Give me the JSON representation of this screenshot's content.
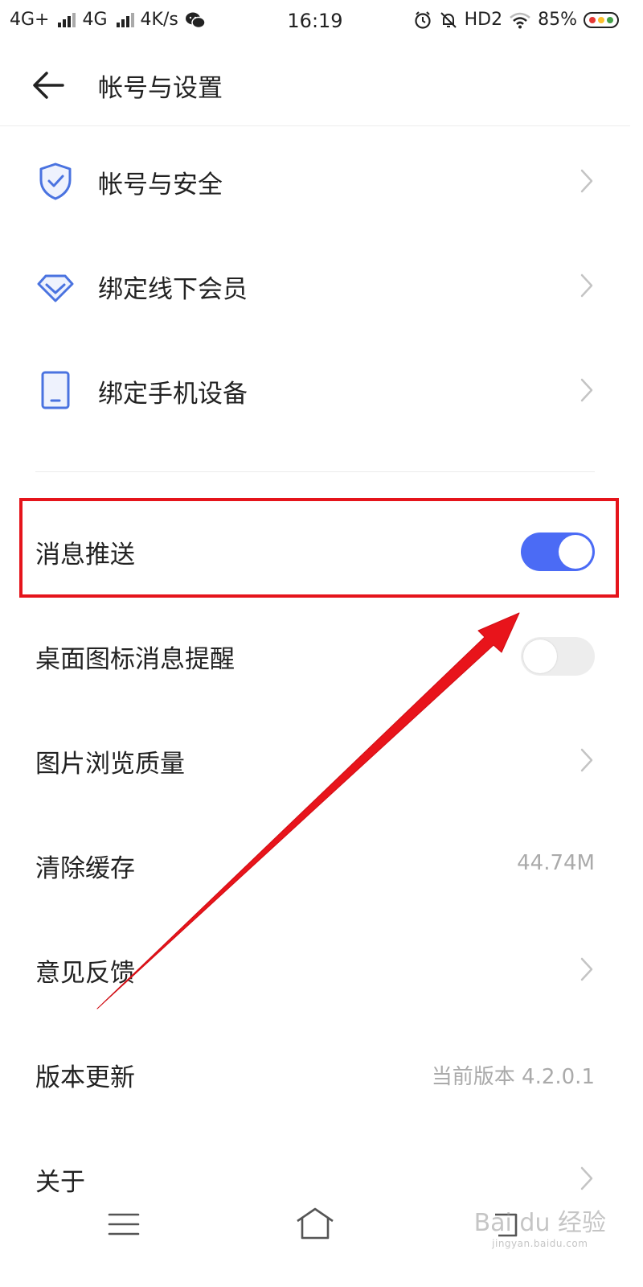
{
  "status_bar": {
    "network1": "4G+",
    "network2": "4G",
    "speed": "4K/s",
    "time": "16:19",
    "hd": "HD2",
    "battery": "85%"
  },
  "header": {
    "title": "帐号与设置"
  },
  "settings": {
    "account_security": "帐号与安全",
    "bind_member": "绑定线下会员",
    "bind_device": "绑定手机设备",
    "push_message": {
      "label": "消息推送",
      "on": true
    },
    "badge_reminder": {
      "label": "桌面图标消息提醒",
      "on": false
    },
    "image_quality": "图片浏览质量",
    "clear_cache": {
      "label": "清除缓存",
      "value": "44.74M"
    },
    "feedback": "意见反馈",
    "version": {
      "label": "版本更新",
      "value": "当前版本 4.2.0.1"
    },
    "about": "关于"
  },
  "watermark": {
    "brand": "Bai du 经验",
    "url": "jingyan.baidu.com"
  },
  "colors": {
    "accent": "#4b6bf5",
    "icon_blue": "#4a73e0",
    "annotation_red": "#e5141b"
  },
  "icons": {
    "back": "arrow-left-icon",
    "shield": "shield-check-icon",
    "diamond": "diamond-icon",
    "phone": "phone-device-icon",
    "chevron": "chevron-right-icon"
  }
}
